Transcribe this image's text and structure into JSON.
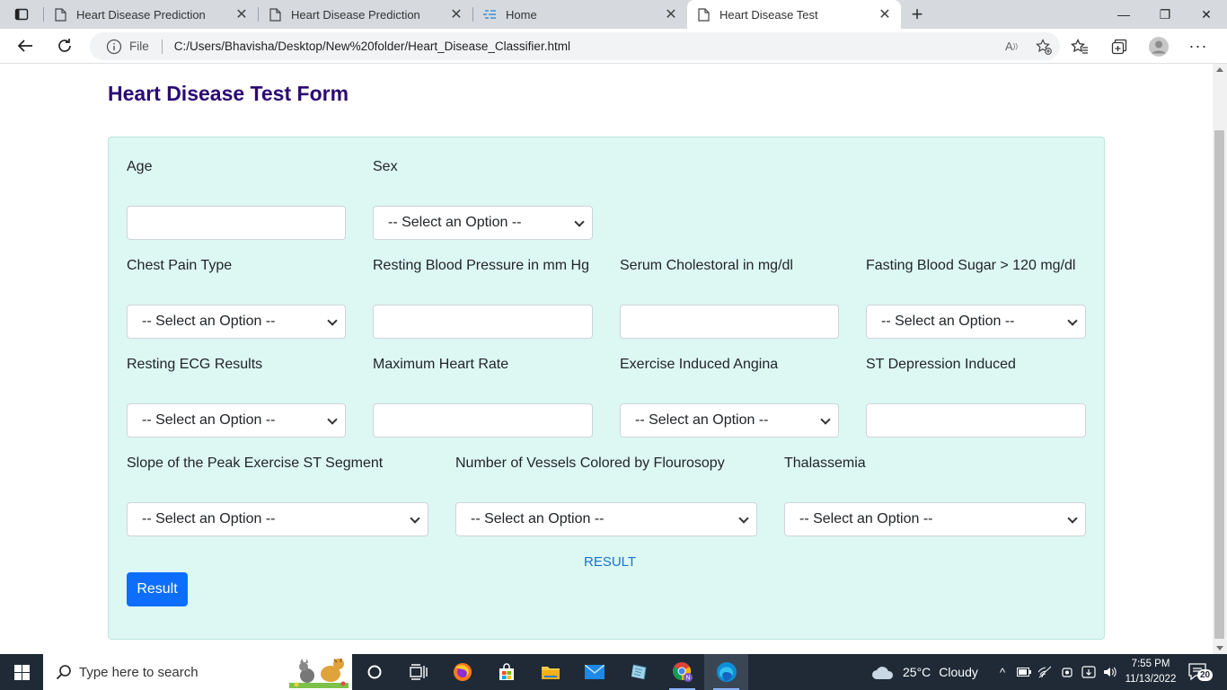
{
  "browser": {
    "tabs": [
      {
        "label": "Heart Disease Prediction",
        "active": false
      },
      {
        "label": "Heart Disease Prediction",
        "active": false
      },
      {
        "label": "Home",
        "active": false
      },
      {
        "label": "Heart Disease Test",
        "active": true
      }
    ],
    "address": {
      "scheme_label": "File",
      "url": "C:/Users/Bhavisha/Desktop/New%20folder/Heart_Disease_Classifier.html"
    }
  },
  "page": {
    "title": "Heart Disease Test Form",
    "fields": {
      "age": {
        "label": "Age",
        "value": ""
      },
      "sex": {
        "label": "Sex",
        "value": "-- Select an Option --"
      },
      "chest_pain": {
        "label": "Chest Pain Type",
        "value": "-- Select an Option --"
      },
      "resting_bp": {
        "label": "Resting Blood Pressure in mm Hg",
        "value": ""
      },
      "cholesterol": {
        "label": "Serum Cholestoral in mg/dl",
        "value": ""
      },
      "fasting_sugar": {
        "label": "Fasting Blood Sugar > 120 mg/dl",
        "value": "-- Select an Option --"
      },
      "resting_ecg": {
        "label": "Resting ECG Results",
        "value": "-- Select an Option --"
      },
      "max_hr": {
        "label": "Maximum Heart Rate",
        "value": ""
      },
      "angina": {
        "label": "Exercise Induced Angina",
        "value": "-- Select an Option --"
      },
      "st_depression": {
        "label": "ST Depression Induced",
        "value": ""
      },
      "slope": {
        "label": "Slope of the Peak Exercise ST Segment",
        "value": "-- Select an Option --"
      },
      "vessels": {
        "label": "Number of Vessels Colored by Flourosopy",
        "value": "-- Select an Option --"
      },
      "thal": {
        "label": "Thalassemia",
        "value": "-- Select an Option --"
      }
    },
    "result_text": "RESULT",
    "result_button": "Result"
  },
  "taskbar": {
    "search_placeholder": "Type here to search",
    "weather": {
      "temp": "25°C",
      "condition": "Cloudy"
    },
    "time": "7:55 PM",
    "date": "11/13/2022",
    "notification_count": "20"
  },
  "colors": {
    "title": "#2b0a73",
    "card_bg": "#ddf7f3",
    "primary_button": "#0d6efd",
    "result_link": "#1a73c9",
    "taskbar": "#1f2a36"
  }
}
